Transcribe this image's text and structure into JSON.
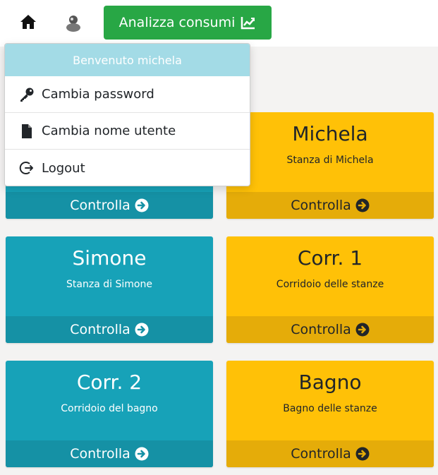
{
  "nav": {
    "analyze_label": "Analizza consumi"
  },
  "user_menu": {
    "header": "Benvenuto michela",
    "items": [
      {
        "label": "Cambia password",
        "icon": "key-icon"
      },
      {
        "label": "Cambia nome utente",
        "icon": "file-icon"
      },
      {
        "label": "Logout",
        "icon": "logout-icon"
      }
    ]
  },
  "rooms": [
    {
      "name": "",
      "description": "",
      "action": "Controlla",
      "color": "teal"
    },
    {
      "name": "Michela",
      "description": "Stanza di Michela",
      "action": "Controlla",
      "color": "yellow"
    },
    {
      "name": "Simone",
      "description": "Stanza di Simone",
      "action": "Controlla",
      "color": "teal"
    },
    {
      "name": "Corr. 1",
      "description": "Corridoio delle stanze",
      "action": "Controlla",
      "color": "yellow"
    },
    {
      "name": "Corr. 2",
      "description": "Corridoio del bagno",
      "action": "Controlla",
      "color": "teal"
    },
    {
      "name": "Bagno",
      "description": "Bagno delle stanze",
      "action": "Controlla",
      "color": "yellow"
    }
  ],
  "colors": {
    "teal": "#17a2b8",
    "yellow": "#ffc107",
    "green": "#28a745",
    "menu_header": "#a3dbe6"
  }
}
